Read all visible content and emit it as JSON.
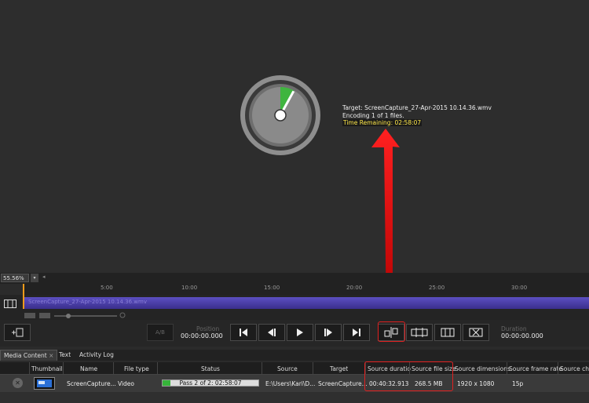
{
  "encoding": {
    "target_line": "Target: ScreenCapture_27-Apr-2015 10.14.36.wmv",
    "encoding_line": "Encoding 1 of 1 files.",
    "time_remaining_line": "Time Remaining: 02:58:07",
    "progress_fraction": 0.08
  },
  "zoom": {
    "value": "55.56%",
    "dropdown": "▾",
    "left_arrow": "◂"
  },
  "ruler": {
    "ticks": [
      "5:00",
      "10:00",
      "15:00",
      "20:00",
      "25:00",
      "30:00"
    ]
  },
  "timeline": {
    "clip_label": "ScreenCapture_27-Apr-2015 10.14.36.wmv"
  },
  "controls": {
    "ab_label": "A/B",
    "position_label": "Position",
    "position_value": "00:00:00.000",
    "duration_label": "Duration",
    "duration_value": "00:00:00.000"
  },
  "tabs": [
    {
      "label": "Media Content",
      "close": "×"
    },
    {
      "label": "Text"
    },
    {
      "label": "Activity Log"
    }
  ],
  "table": {
    "headers": [
      "Thumbnail",
      "Name",
      "File type",
      "Status",
      "Source",
      "Target",
      "Source duratio",
      "Source file size",
      "Source dimensions",
      "Source frame rate",
      "Source cha"
    ],
    "row": {
      "name": "ScreenCapture...",
      "file_type": "Video",
      "status": "Pass 2 of 2: 02:58:07",
      "status_progress": 0.08,
      "source": "E:\\Users\\Kari\\D...",
      "target": "ScreenCapture...",
      "source_duration": "00:40:32.913",
      "source_file_size": "268.5 MB",
      "source_dimensions": "1920 x 1080",
      "source_frame_rate": "15p"
    }
  },
  "colors": {
    "accent_green": "#36b43a",
    "highlight_yellow": "#ffe84a",
    "annotation_red": "#e02020",
    "clip_purple": "#5c4fc2",
    "playhead_orange": "#f09a1a"
  }
}
